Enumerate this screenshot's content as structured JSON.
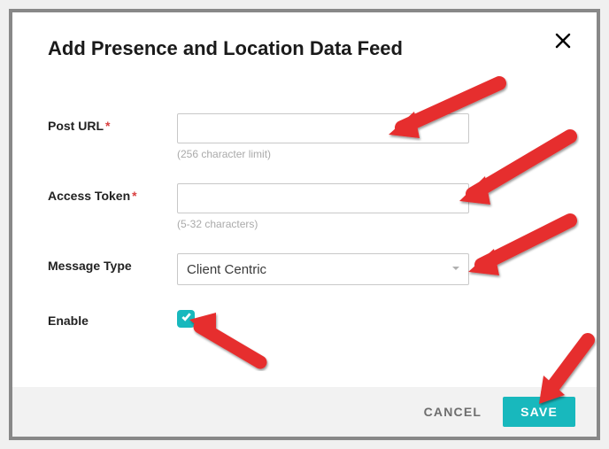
{
  "modal": {
    "title": "Add Presence and Location Data Feed",
    "fields": {
      "postUrl": {
        "label": "Post URL",
        "value": "",
        "hint": "(256 character limit)"
      },
      "accessToken": {
        "label": "Access Token",
        "value": "",
        "hint": "(5-32 characters)"
      },
      "messageType": {
        "label": "Message Type",
        "selected": "Client Centric"
      },
      "enable": {
        "label": "Enable",
        "checked": true
      }
    },
    "buttons": {
      "cancel": "CANCEL",
      "save": "SAVE"
    }
  }
}
